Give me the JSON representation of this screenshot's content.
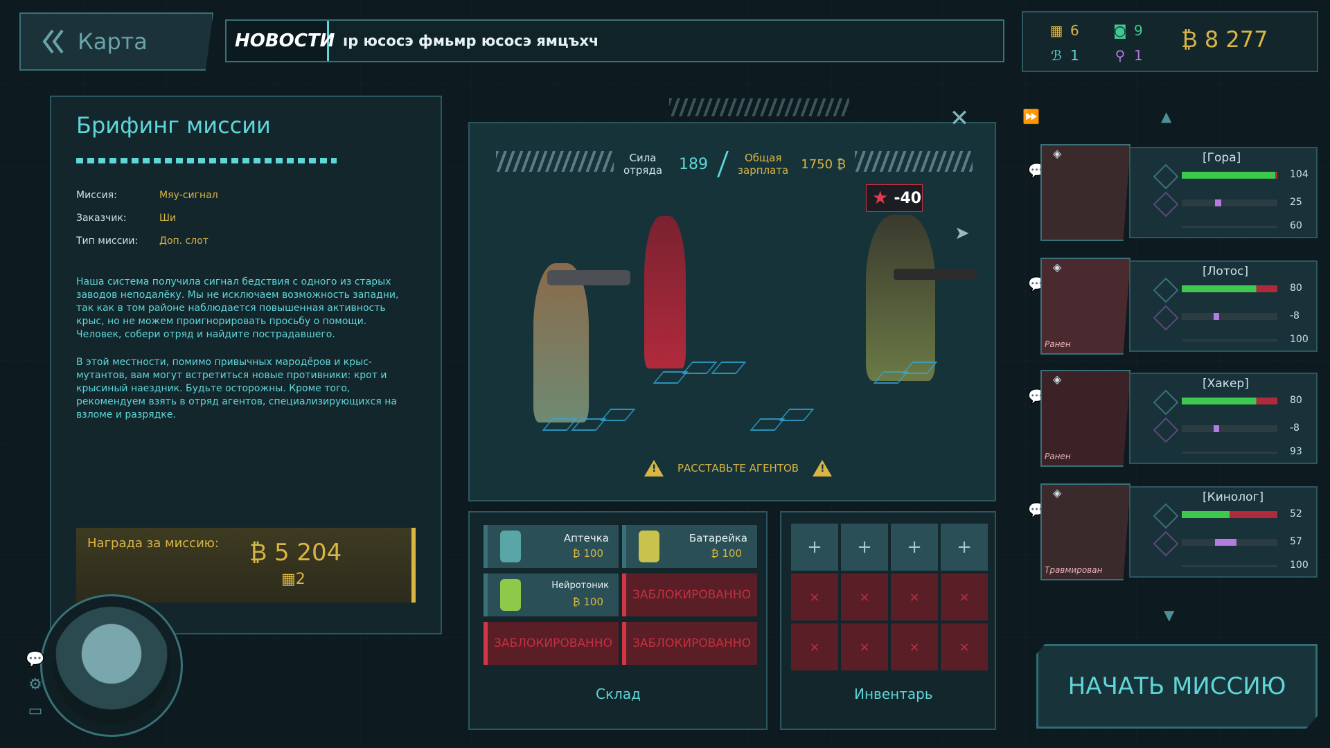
{
  "topbar": {
    "back_label": "Карта",
    "news_label": "НОВОСТИ",
    "news_text": "ıр юсосэ фмьмр юсосэ ямцъхч"
  },
  "resources": {
    "tokens": "6",
    "photos": "9",
    "dna": "1",
    "agents": "1",
    "money": "₿ 8 277"
  },
  "briefing": {
    "title": "Брифинг миссии",
    "mission_key": "Миссия:",
    "mission_value": "Мяу-сигнал",
    "client_key": "Заказчик:",
    "client_value": "Ши",
    "type_key": "Тип миссии:",
    "type_value": "Доп. слот",
    "desc1": "Наша система получила сигнал бедствия с одного из старых заводов неподалёку. Мы не исключаем возможность западни, так как в том районе наблюдается повышенная активность крыс, но не можем проигнорировать просьбу о помощи. Человек, собери отряд и найдите пострадавшего.",
    "desc2": "В этой местности, помимо привычных мародёров и крыс-мутантов, вам могут встретиться новые противники: крот и крысиный наездник. Будьте осторожны. Кроме того, рекомендуем взять в отряд агентов, специализирующихся на взломе и разрядке.",
    "reward_label": "Награда за миссию:",
    "reward_amount": "₿ 5 204",
    "reward_tokens": "2"
  },
  "squad": {
    "strength_label_1": "Сила",
    "strength_label_2": "отряда",
    "strength_value": "189",
    "salary_label_1": "Общая",
    "salary_label_2": "зарплата",
    "salary_value": "1750 ₿",
    "enemy_value": "-40",
    "warning": "РАССТАВЬТЕ АГЕНТОВ"
  },
  "storage": {
    "label": "Склад",
    "items": [
      {
        "name": "Аптечка",
        "price": "₿ 100"
      },
      {
        "name": "Батарейка",
        "price": "₿ 100"
      },
      {
        "name": "Нейротоник",
        "price": "₿ 100"
      }
    ],
    "locked_label": "ЗАБЛОКИРОВАННО"
  },
  "inventory": {
    "label": "Инвентарь",
    "add_glyph": "+",
    "locked_glyph": "×"
  },
  "agents": [
    {
      "name": "[Гора]",
      "hp": 104,
      "hp_frac": 0.98,
      "morale": 25,
      "morale_pos": 0.35,
      "xp": 60,
      "status": ""
    },
    {
      "name": "[Лотос]",
      "hp": 80,
      "hp_frac": 0.78,
      "morale": -8,
      "morale_pos": 0.33,
      "xp": 100,
      "status": "Ранен"
    },
    {
      "name": "[Хакер]",
      "hp": 80,
      "hp_frac": 0.78,
      "morale": -8,
      "morale_pos": 0.33,
      "xp": 93,
      "status": "Ранен"
    },
    {
      "name": "[Кинолог]",
      "hp": 52,
      "hp_frac": 0.5,
      "morale": 57,
      "morale_pos": 0.35,
      "xp": 100,
      "status": "Травмирован"
    }
  ],
  "start_button": "НАЧАТЬ МИССИЮ",
  "colors": {
    "accent": "#5fd6d8",
    "gold": "#d9b544",
    "locked": "#c43040",
    "panel": "#13262c"
  }
}
